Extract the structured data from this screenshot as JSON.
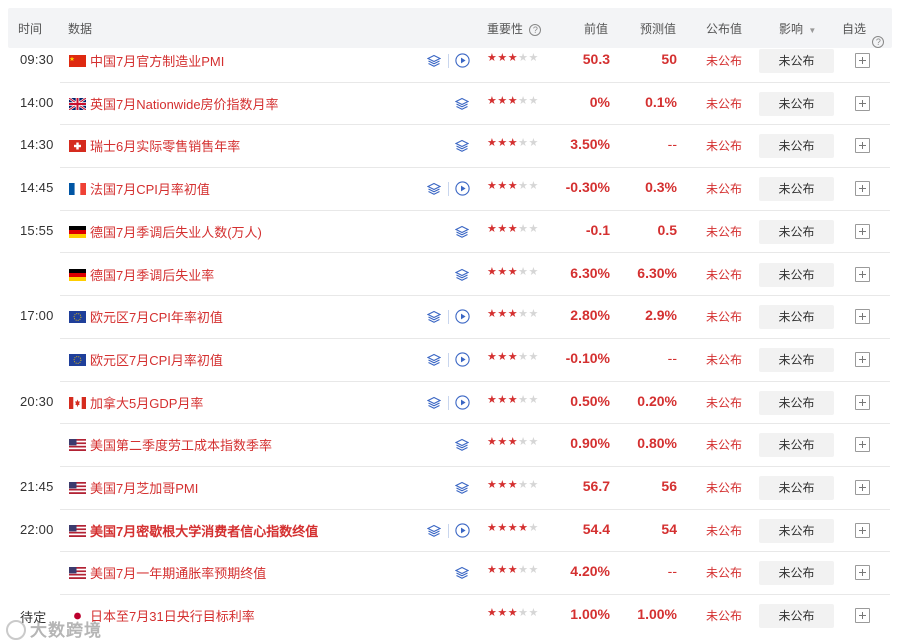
{
  "header": {
    "time": "时间",
    "data": "数据",
    "importance": "重要性",
    "previous": "前值",
    "forecast": "预测值",
    "actual": "公布值",
    "impact": "影响",
    "watchlist": "自选"
  },
  "rows": [
    {
      "time": "09:30",
      "flag": "cn",
      "name": "中国7月官方制造业PMI",
      "bold": false,
      "icons": "both",
      "stars": 3,
      "prev": "50.3",
      "fore": "50",
      "actual": "未公布",
      "impact": "未公布"
    },
    {
      "time": "14:00",
      "flag": "gb",
      "name": "英国7月Nationwide房价指数月率",
      "bold": false,
      "icons": "layers",
      "stars": 3,
      "prev": "0%",
      "fore": "0.1%",
      "actual": "未公布",
      "impact": "未公布"
    },
    {
      "time": "14:30",
      "flag": "ch",
      "name": "瑞士6月实际零售销售年率",
      "bold": false,
      "icons": "layers",
      "stars": 3,
      "prev": "3.50%",
      "fore": "--",
      "actual": "未公布",
      "impact": "未公布"
    },
    {
      "time": "14:45",
      "flag": "fr",
      "name": "法国7月CPI月率初值",
      "bold": false,
      "icons": "both",
      "stars": 3,
      "prev": "-0.30%",
      "fore": "0.3%",
      "actual": "未公布",
      "impact": "未公布"
    },
    {
      "time": "15:55",
      "flag": "de",
      "name": "德国7月季调后失业人数(万人)",
      "bold": false,
      "icons": "layers",
      "stars": 3,
      "prev": "-0.1",
      "fore": "0.5",
      "actual": "未公布",
      "impact": "未公布"
    },
    {
      "time": "",
      "flag": "de",
      "name": "德国7月季调后失业率",
      "bold": false,
      "icons": "layers",
      "stars": 3,
      "prev": "6.30%",
      "fore": "6.30%",
      "actual": "未公布",
      "impact": "未公布"
    },
    {
      "time": "17:00",
      "flag": "eu",
      "name": "欧元区7月CPI年率初值",
      "bold": false,
      "icons": "both",
      "stars": 3,
      "prev": "2.80%",
      "fore": "2.9%",
      "actual": "未公布",
      "impact": "未公布"
    },
    {
      "time": "",
      "flag": "eu",
      "name": "欧元区7月CPI月率初值",
      "bold": false,
      "icons": "both",
      "stars": 3,
      "prev": "-0.10%",
      "fore": "--",
      "actual": "未公布",
      "impact": "未公布"
    },
    {
      "time": "20:30",
      "flag": "ca",
      "name": "加拿大5月GDP月率",
      "bold": false,
      "icons": "both",
      "stars": 3,
      "prev": "0.50%",
      "fore": "0.20%",
      "actual": "未公布",
      "impact": "未公布"
    },
    {
      "time": "",
      "flag": "us",
      "name": "美国第二季度劳工成本指数季率",
      "bold": false,
      "icons": "layers",
      "stars": 3,
      "prev": "0.90%",
      "fore": "0.80%",
      "actual": "未公布",
      "impact": "未公布"
    },
    {
      "time": "21:45",
      "flag": "us",
      "name": "美国7月芝加哥PMI",
      "bold": false,
      "icons": "layers",
      "stars": 3,
      "prev": "56.7",
      "fore": "56",
      "actual": "未公布",
      "impact": "未公布"
    },
    {
      "time": "22:00",
      "flag": "us",
      "name": "美国7月密歇根大学消费者信心指数终值",
      "bold": true,
      "icons": "both",
      "stars": 4,
      "prev": "54.4",
      "fore": "54",
      "actual": "未公布",
      "impact": "未公布"
    },
    {
      "time": "",
      "flag": "us",
      "name": "美国7月一年期通胀率预期终值",
      "bold": false,
      "icons": "layers",
      "stars": 3,
      "prev": "4.20%",
      "fore": "--",
      "actual": "未公布",
      "impact": "未公布"
    },
    {
      "time": "待定",
      "flag": "jp",
      "name": "日本至7月31日央行目标利率",
      "bold": false,
      "icons": "none",
      "stars": 3,
      "prev": "1.00%",
      "fore": "1.00%",
      "actual": "未公布",
      "impact": "未公布"
    }
  ],
  "watermark": "大数跨境",
  "colors": {
    "accent": "#d43030",
    "header_bg": "#f3f4f6",
    "icon_blue": "#3a66c4"
  }
}
